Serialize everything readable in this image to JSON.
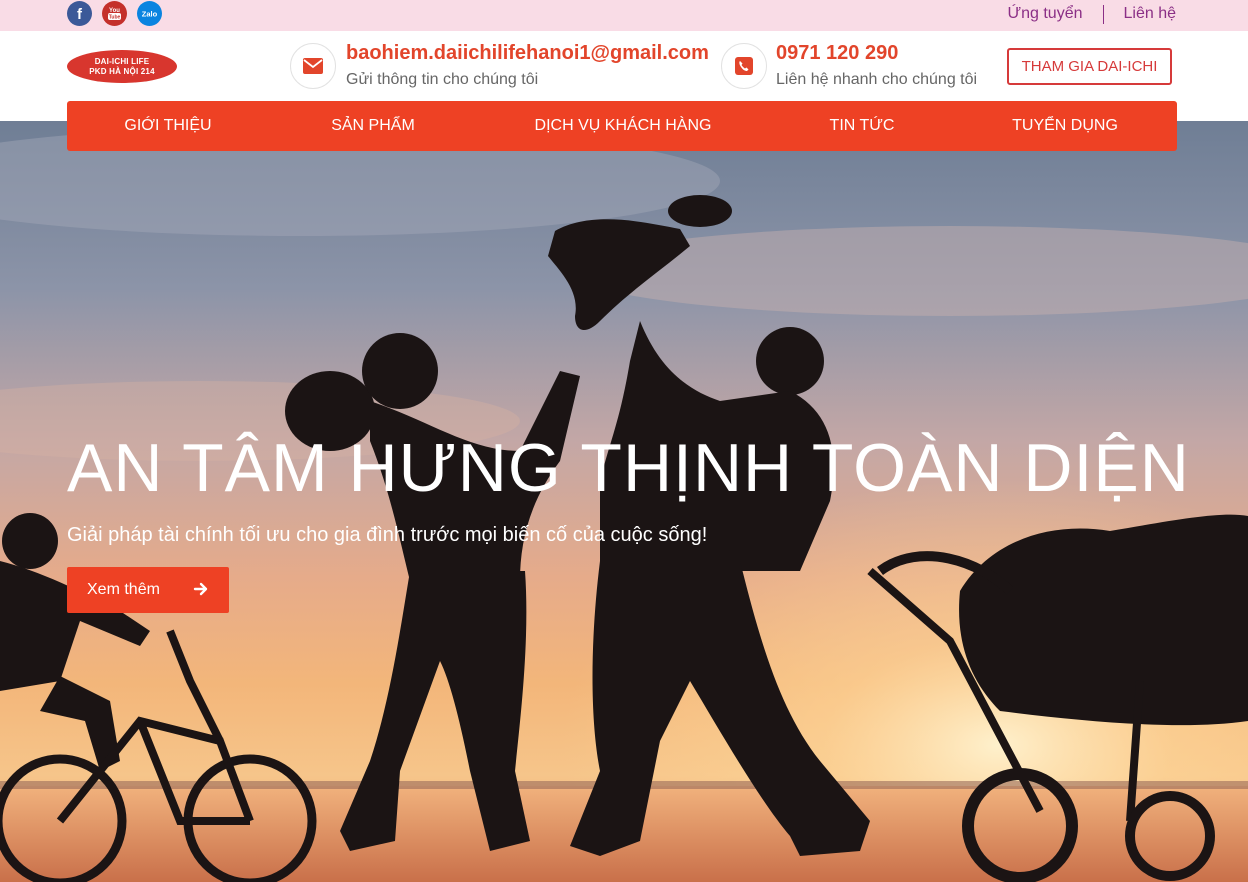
{
  "topbar": {
    "social": [
      {
        "name": "facebook-icon",
        "glyph": "f"
      },
      {
        "name": "youtube-icon",
        "glyph": "You Tube"
      },
      {
        "name": "zalo-icon",
        "glyph": "Zalo"
      }
    ],
    "links": [
      "Ứng tuyển",
      "Liên hệ"
    ]
  },
  "header": {
    "logo_line1": "DAI-ICHI LIFE",
    "logo_line2": "PKD HÀ NỘI 214",
    "email": {
      "title": "baohiem.daiichilifehanoi1@gmail.com",
      "subtitle": "Gửi thông tin cho chúng tôi",
      "icon": "envelope-icon"
    },
    "phone": {
      "title": "0971 120 290",
      "subtitle": "Liên hệ nhanh cho chúng tôi",
      "icon": "phone-icon"
    },
    "join_button": "THAM GIA DAI-ICHI"
  },
  "nav": {
    "items": [
      "GIỚI THIỆU",
      "SẢN PHẨM",
      "DỊCH VỤ KHÁCH HÀNG",
      "TIN TỨC",
      "TUYỂN DỤNG"
    ]
  },
  "hero": {
    "title": "AN TÂM HƯNG THỊNH TOÀN DIỆN",
    "subtitle": "Giải pháp tài chính tối ưu cho gia đình trước mọi biến cố của cuộc sống!",
    "button": "Xem thêm",
    "button_icon": "arrow-right-icon"
  },
  "colors": {
    "accent": "#ee4124",
    "topbar_bg": "#f9dce6",
    "toplink": "#8b2f86"
  }
}
